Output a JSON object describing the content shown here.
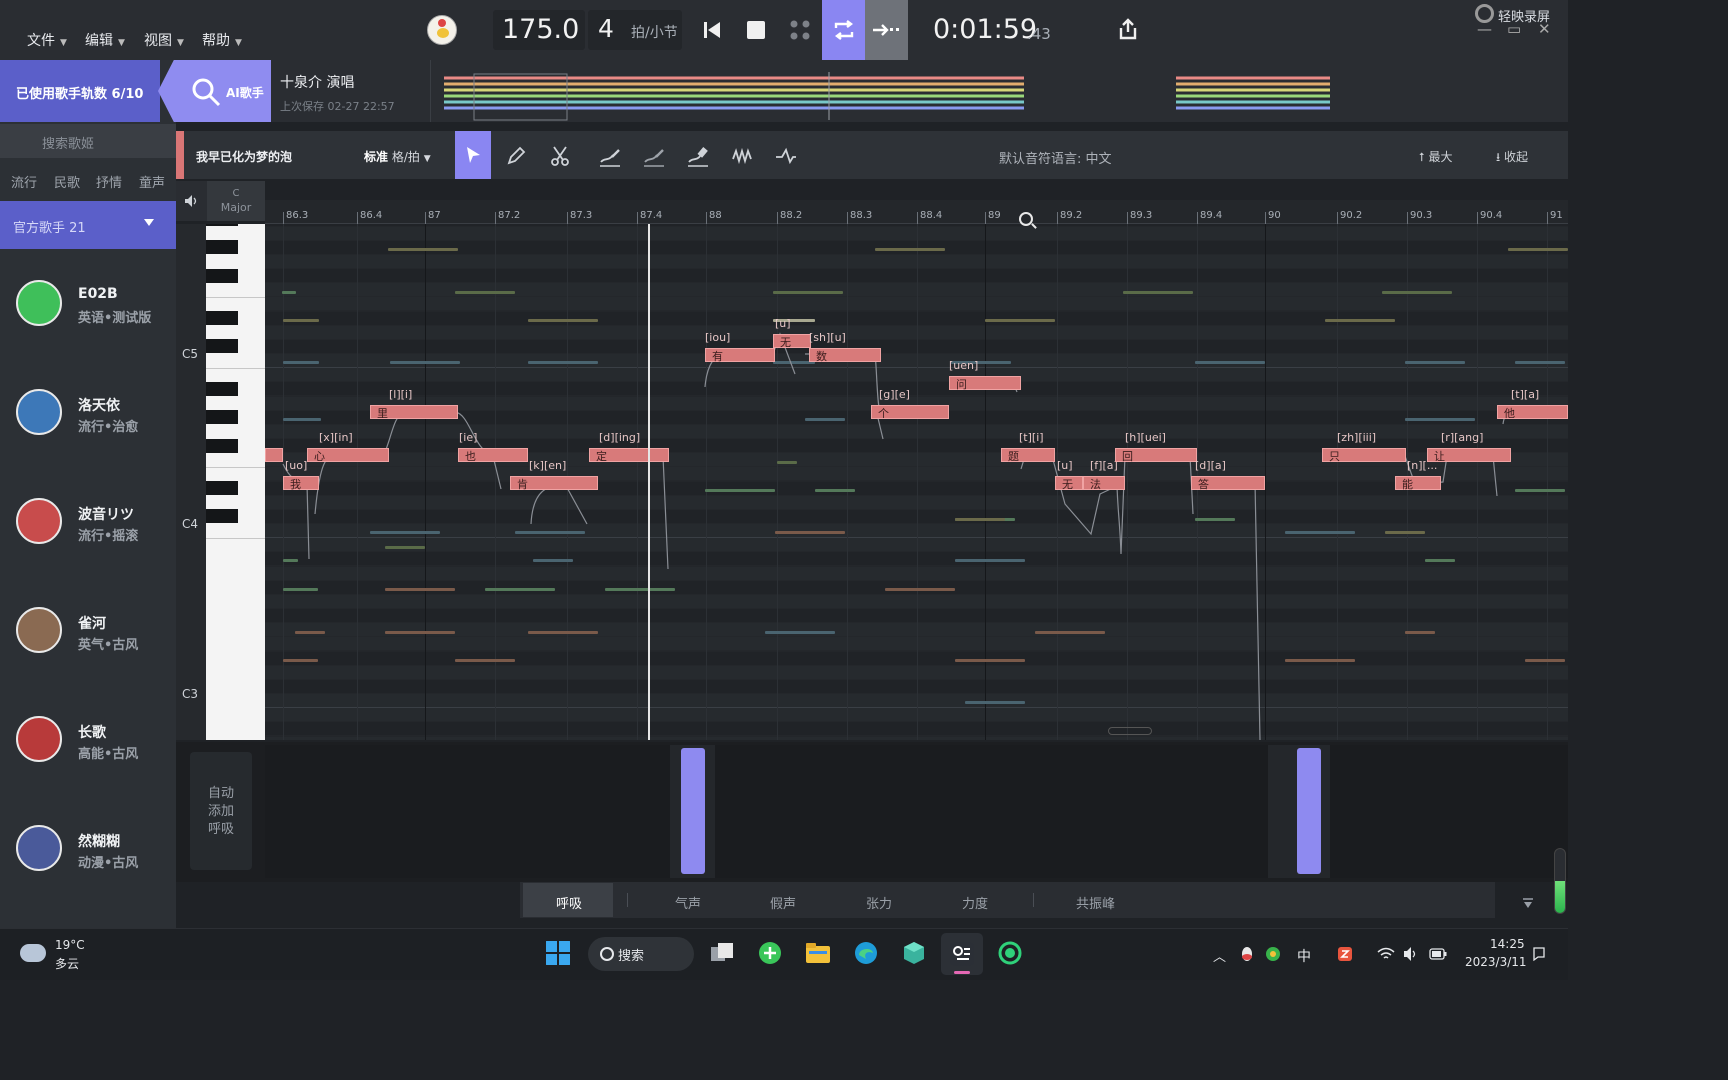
{
  "menu": {
    "file": "文件",
    "edit": "编辑",
    "view": "视图",
    "help": "帮助"
  },
  "transport": {
    "tempo": "175.0",
    "beats": "4",
    "beats_unit": "拍/小节",
    "time_main": "0:01:59",
    "time_ms": ".43"
  },
  "brand": "轻映录屏",
  "left": {
    "quota": "已使用歌手轨数 6/10",
    "ai_singer": "AI歌手",
    "search_placeholder": "搜索歌姬",
    "genres": [
      "流行",
      "民歌",
      "抒情",
      "童声"
    ],
    "official": "官方歌手 21",
    "singers": [
      {
        "name": "E02B",
        "tag": "英语•测试版",
        "color": "#3fbf5a"
      },
      {
        "name": "洛天依",
        "tag": "流行•治愈",
        "color": "#3d78b8"
      },
      {
        "name": "波音リツ",
        "tag": "流行•摇滚",
        "color": "#c84c4c"
      },
      {
        "name": "雀河",
        "tag": "英气•古风",
        "color": "#8a6a52"
      },
      {
        "name": "长歌",
        "tag": "高能•古风",
        "color": "#b83a3a"
      },
      {
        "name": "然糊糊",
        "tag": "动漫•古风",
        "color": "#4a5a9a"
      }
    ]
  },
  "project": {
    "title": "十泉介 演唱",
    "saved": "上次保存 02-27 22:57"
  },
  "toolbar": {
    "track_name": "我早已化为梦的泡",
    "grid_label": "标准",
    "grid_value": "格/拍",
    "lyric_lang": "默认音符语言: 中文",
    "max": "最大",
    "collapse": "收起"
  },
  "scale": {
    "key": "C",
    "mode": "Major"
  },
  "octaves": [
    "C5",
    "C4",
    "C3"
  ],
  "ruler": [
    "86.3",
    "86.4",
    "87",
    "87.2",
    "87.3",
    "87.4",
    "88",
    "88.2",
    "88.3",
    "88.4",
    "89",
    "89.2",
    "89.3",
    "89.4",
    "90",
    "90.2",
    "90.3",
    "90.4",
    "91"
  ],
  "notes": [
    {
      "lyric": "我",
      "phon": "[uo]"
    },
    {
      "lyric": "心",
      "phon": "[x][in]"
    },
    {
      "lyric": "里",
      "phon": "[l][i]"
    },
    {
      "lyric": "也",
      "phon": "[ie]"
    },
    {
      "lyric": "肯",
      "phon": "[k][en]"
    },
    {
      "lyric": "定",
      "phon": "[d][ing]"
    },
    {
      "lyric": "有",
      "phon": "[iou]"
    },
    {
      "lyric": "无",
      "phon": "[u]"
    },
    {
      "lyric": "数",
      "phon": "[sh][u]"
    },
    {
      "lyric": "个",
      "phon": "[g][e]"
    },
    {
      "lyric": "问",
      "phon": "[uen]"
    },
    {
      "lyric": "题",
      "phon": "[t][i]"
    },
    {
      "lyric": "无",
      "phon": "[u]"
    },
    {
      "lyric": "法",
      "phon": "[f][a]"
    },
    {
      "lyric": "回",
      "phon": "[h][uei]"
    },
    {
      "lyric": "答",
      "phon": "[d][a]"
    },
    {
      "lyric": "只",
      "phon": "[zh][iii]"
    },
    {
      "lyric": "能",
      "phon": "[n][..."
    },
    {
      "lyric": "让",
      "phon": "[r][ang]"
    },
    {
      "lyric": "他",
      "phon": "[t][a]"
    }
  ],
  "param": {
    "auto_breath": [
      "自动",
      "添加",
      "呼吸"
    ],
    "tabs": [
      "呼吸",
      "气声",
      "假声",
      "张力",
      "力度",
      "共振峰"
    ]
  },
  "taskbar": {
    "temp": "19°C",
    "cond": "多云",
    "search": "搜索",
    "ime": "中",
    "time": "14:25",
    "date": "2023/3/11"
  },
  "colors": {
    "accent": "#8a86f2",
    "note": "#d87a7a",
    "panel": "#2c3035"
  }
}
